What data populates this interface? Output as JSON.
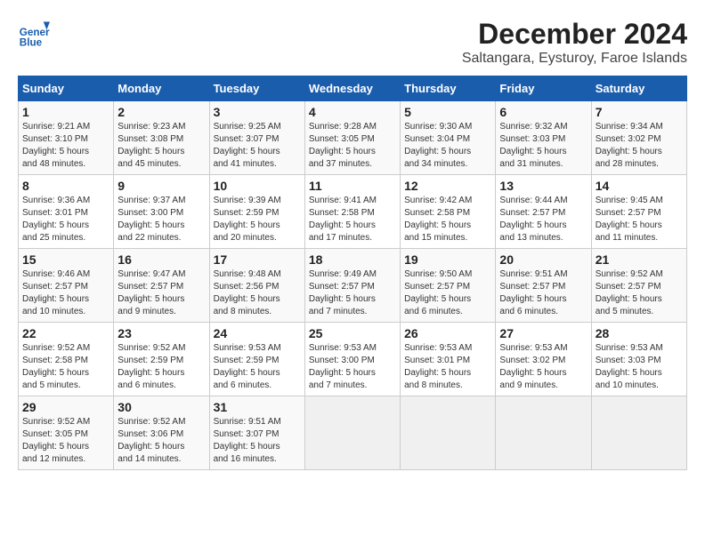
{
  "header": {
    "logo_line1": "General",
    "logo_line2": "Blue",
    "title": "December 2024",
    "subtitle": "Saltangara, Eysturoy, Faroe Islands"
  },
  "days_of_week": [
    "Sunday",
    "Monday",
    "Tuesday",
    "Wednesday",
    "Thursday",
    "Friday",
    "Saturday"
  ],
  "weeks": [
    [
      {
        "day": 1,
        "info": "Sunrise: 9:21 AM\nSunset: 3:10 PM\nDaylight: 5 hours\nand 48 minutes."
      },
      {
        "day": 2,
        "info": "Sunrise: 9:23 AM\nSunset: 3:08 PM\nDaylight: 5 hours\nand 45 minutes."
      },
      {
        "day": 3,
        "info": "Sunrise: 9:25 AM\nSunset: 3:07 PM\nDaylight: 5 hours\nand 41 minutes."
      },
      {
        "day": 4,
        "info": "Sunrise: 9:28 AM\nSunset: 3:05 PM\nDaylight: 5 hours\nand 37 minutes."
      },
      {
        "day": 5,
        "info": "Sunrise: 9:30 AM\nSunset: 3:04 PM\nDaylight: 5 hours\nand 34 minutes."
      },
      {
        "day": 6,
        "info": "Sunrise: 9:32 AM\nSunset: 3:03 PM\nDaylight: 5 hours\nand 31 minutes."
      },
      {
        "day": 7,
        "info": "Sunrise: 9:34 AM\nSunset: 3:02 PM\nDaylight: 5 hours\nand 28 minutes."
      }
    ],
    [
      {
        "day": 8,
        "info": "Sunrise: 9:36 AM\nSunset: 3:01 PM\nDaylight: 5 hours\nand 25 minutes."
      },
      {
        "day": 9,
        "info": "Sunrise: 9:37 AM\nSunset: 3:00 PM\nDaylight: 5 hours\nand 22 minutes."
      },
      {
        "day": 10,
        "info": "Sunrise: 9:39 AM\nSunset: 2:59 PM\nDaylight: 5 hours\nand 20 minutes."
      },
      {
        "day": 11,
        "info": "Sunrise: 9:41 AM\nSunset: 2:58 PM\nDaylight: 5 hours\nand 17 minutes."
      },
      {
        "day": 12,
        "info": "Sunrise: 9:42 AM\nSunset: 2:58 PM\nDaylight: 5 hours\nand 15 minutes."
      },
      {
        "day": 13,
        "info": "Sunrise: 9:44 AM\nSunset: 2:57 PM\nDaylight: 5 hours\nand 13 minutes."
      },
      {
        "day": 14,
        "info": "Sunrise: 9:45 AM\nSunset: 2:57 PM\nDaylight: 5 hours\nand 11 minutes."
      }
    ],
    [
      {
        "day": 15,
        "info": "Sunrise: 9:46 AM\nSunset: 2:57 PM\nDaylight: 5 hours\nand 10 minutes."
      },
      {
        "day": 16,
        "info": "Sunrise: 9:47 AM\nSunset: 2:57 PM\nDaylight: 5 hours\nand 9 minutes."
      },
      {
        "day": 17,
        "info": "Sunrise: 9:48 AM\nSunset: 2:56 PM\nDaylight: 5 hours\nand 8 minutes."
      },
      {
        "day": 18,
        "info": "Sunrise: 9:49 AM\nSunset: 2:57 PM\nDaylight: 5 hours\nand 7 minutes."
      },
      {
        "day": 19,
        "info": "Sunrise: 9:50 AM\nSunset: 2:57 PM\nDaylight: 5 hours\nand 6 minutes."
      },
      {
        "day": 20,
        "info": "Sunrise: 9:51 AM\nSunset: 2:57 PM\nDaylight: 5 hours\nand 6 minutes."
      },
      {
        "day": 21,
        "info": "Sunrise: 9:52 AM\nSunset: 2:57 PM\nDaylight: 5 hours\nand 5 minutes."
      }
    ],
    [
      {
        "day": 22,
        "info": "Sunrise: 9:52 AM\nSunset: 2:58 PM\nDaylight: 5 hours\nand 5 minutes."
      },
      {
        "day": 23,
        "info": "Sunrise: 9:52 AM\nSunset: 2:59 PM\nDaylight: 5 hours\nand 6 minutes."
      },
      {
        "day": 24,
        "info": "Sunrise: 9:53 AM\nSunset: 2:59 PM\nDaylight: 5 hours\nand 6 minutes."
      },
      {
        "day": 25,
        "info": "Sunrise: 9:53 AM\nSunset: 3:00 PM\nDaylight: 5 hours\nand 7 minutes."
      },
      {
        "day": 26,
        "info": "Sunrise: 9:53 AM\nSunset: 3:01 PM\nDaylight: 5 hours\nand 8 minutes."
      },
      {
        "day": 27,
        "info": "Sunrise: 9:53 AM\nSunset: 3:02 PM\nDaylight: 5 hours\nand 9 minutes."
      },
      {
        "day": 28,
        "info": "Sunrise: 9:53 AM\nSunset: 3:03 PM\nDaylight: 5 hours\nand 10 minutes."
      }
    ],
    [
      {
        "day": 29,
        "info": "Sunrise: 9:52 AM\nSunset: 3:05 PM\nDaylight: 5 hours\nand 12 minutes."
      },
      {
        "day": 30,
        "info": "Sunrise: 9:52 AM\nSunset: 3:06 PM\nDaylight: 5 hours\nand 14 minutes."
      },
      {
        "day": 31,
        "info": "Sunrise: 9:51 AM\nSunset: 3:07 PM\nDaylight: 5 hours\nand 16 minutes."
      },
      null,
      null,
      null,
      null
    ]
  ]
}
